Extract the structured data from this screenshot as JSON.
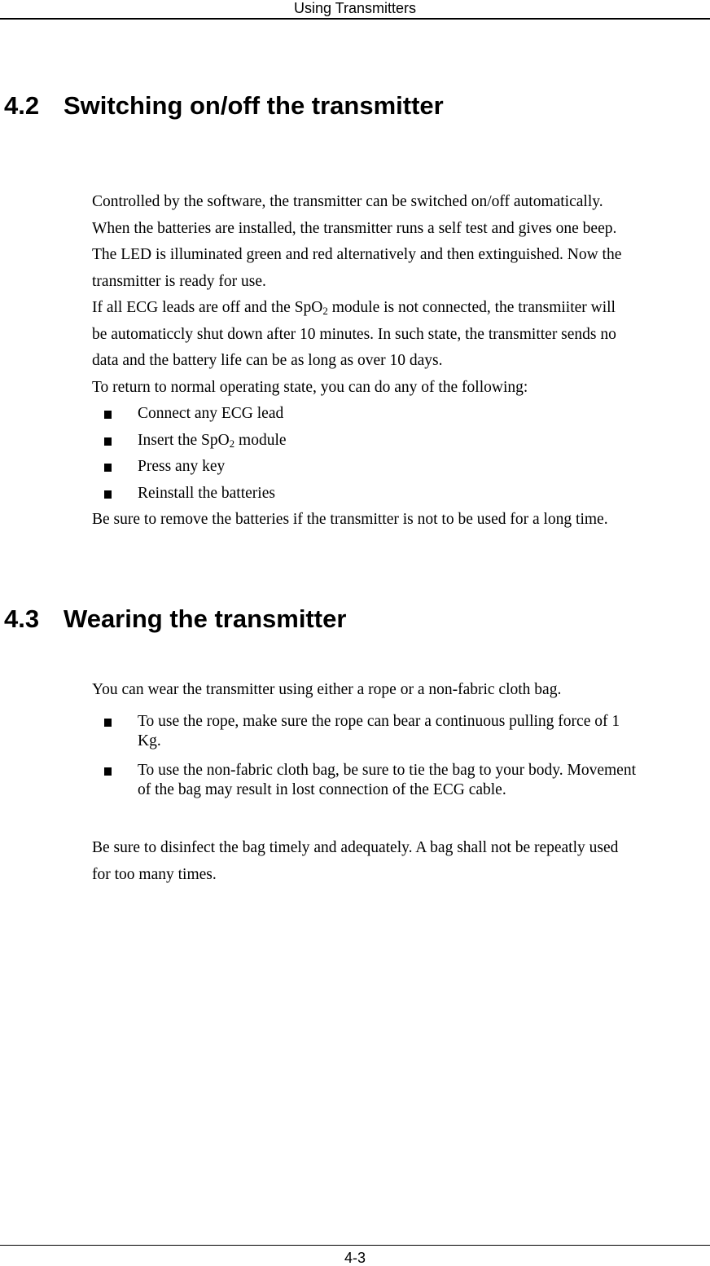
{
  "header": {
    "title": "Using Transmitters"
  },
  "footer": {
    "page_number": "4-3"
  },
  "section_4_2": {
    "number": "4.2",
    "title": "Switching on/off the transmitter",
    "paragraph_lines": [
      "Controlled by the software, the transmitter can be switched on/off automatically.",
      "When the batteries are installed, the transmitter runs a self test and gives one beep.",
      "The LED is illuminated green and red alternatively and then extinguished. Now the",
      "transmitter is ready for use."
    ],
    "shutdown_line1_pre": "If all ECG leads are off and the SpO",
    "shutdown_line1_sub": "2",
    "shutdown_line1_post": " module is not connected, the transmiiter will",
    "shutdown_lines": [
      "be automaticcly shut down after 10 minutes. In such state, the transmitter sends no",
      "data and the battery life can be as long as over 10 days.",
      "To return to normal operating state, you can do any of the following:"
    ],
    "bullets": [
      {
        "text": "Connect any ECG lead"
      },
      {
        "pre": "Insert the SpO",
        "sub": "2",
        "post": " module"
      },
      {
        "text": "Press any key"
      },
      {
        "text": "Reinstall the batteries"
      }
    ],
    "closing": "Be sure to remove the batteries if the transmitter is not to be used for a long time."
  },
  "section_4_3": {
    "number": "4.3",
    "title": "Wearing the transmitter",
    "intro": "You can wear the transmitter using either a rope or a non-fabric cloth bag.",
    "bullets": [
      {
        "line1": "To use the rope, make sure the rope can bear a continuous pulling force of 1",
        "line2": "Kg."
      },
      {
        "line1": "To use the non-fabric cloth bag, be sure to tie the bag to your body. Movement",
        "line2": "of the bag may result in lost connection of the ECG cable."
      }
    ],
    "closing_lines": [
      "Be sure to disinfect the bag timely and adequately. A bag shall not be repeatly used",
      "for too many times."
    ]
  }
}
